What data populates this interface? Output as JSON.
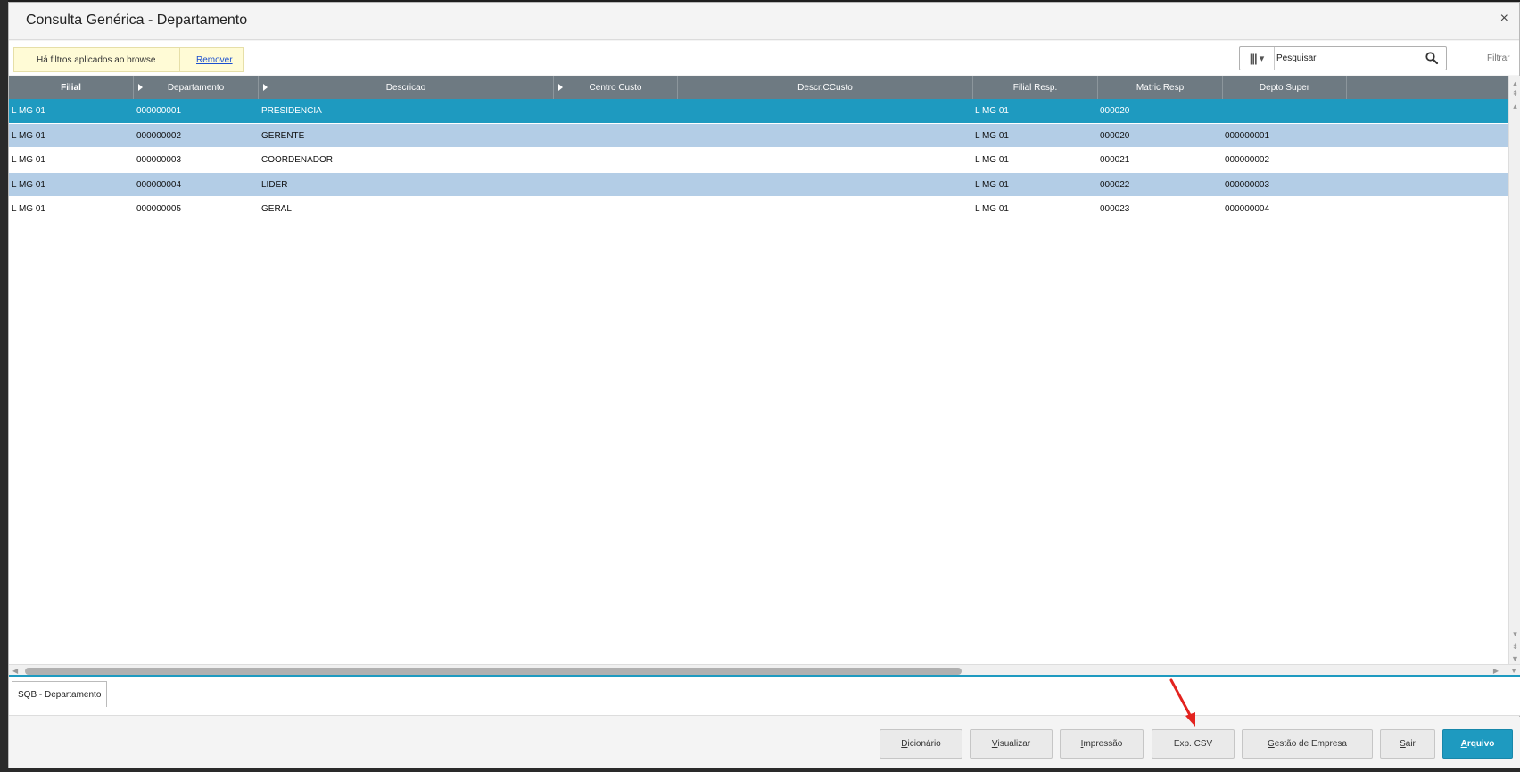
{
  "window": {
    "title": "Consulta Genérica - Departamento",
    "close_label": "×"
  },
  "toolbar": {
    "filter_notice": "Há filtros aplicados ao browse",
    "remove_link": "Remover",
    "search_placeholder": "Pesquisar",
    "filter_label": "Filtrar"
  },
  "grid": {
    "columns": [
      "Filial",
      "Departamento",
      "Descricao",
      "Centro Custo",
      "Descr.CCusto",
      "Filial Resp.",
      "Matric Resp",
      "Depto Super"
    ],
    "rows": [
      {
        "filial": "L MG 01",
        "departamento": "000000001",
        "descricao": "PRESIDENCIA",
        "centro_custo": "",
        "descr_ccusto": "",
        "filial_resp": "L MG 01",
        "matric_resp": "000020",
        "depto_super": "",
        "state": "selected"
      },
      {
        "filial": "L MG 01",
        "departamento": "000000002",
        "descricao": "GERENTE",
        "centro_custo": "",
        "descr_ccusto": "",
        "filial_resp": "L MG 01",
        "matric_resp": "000020",
        "depto_super": "000000001",
        "state": "alt"
      },
      {
        "filial": "L MG 01",
        "departamento": "000000003",
        "descricao": "COORDENADOR",
        "centro_custo": "",
        "descr_ccusto": "",
        "filial_resp": "L MG 01",
        "matric_resp": "000021",
        "depto_super": "000000002",
        "state": "plain"
      },
      {
        "filial": "L MG 01",
        "departamento": "000000004",
        "descricao": "LIDER",
        "centro_custo": "",
        "descr_ccusto": "",
        "filial_resp": "L MG 01",
        "matric_resp": "000022",
        "depto_super": "000000003",
        "state": "alt"
      },
      {
        "filial": "L MG 01",
        "departamento": "000000005",
        "descricao": "GERAL",
        "centro_custo": "",
        "descr_ccusto": "",
        "filial_resp": "L MG 01",
        "matric_resp": "000023",
        "depto_super": "000000004",
        "state": "plain"
      }
    ]
  },
  "tabs": [
    {
      "label": "SQB - Departamento"
    }
  ],
  "footer": {
    "buttons": [
      {
        "label": "Dicionário",
        "mnemonic": "D",
        "rest": "icionário"
      },
      {
        "label": "Visualizar",
        "mnemonic": "V",
        "rest": "isualizar"
      },
      {
        "label": "Impressão",
        "mnemonic": "I",
        "rest": "mpressão"
      },
      {
        "label": "Exp. CSV",
        "mnemonic": "",
        "rest": "Exp. CSV"
      },
      {
        "label": "Gestão de Empresa",
        "mnemonic": "G",
        "rest": "estão de Empresa"
      },
      {
        "label": "Sair",
        "mnemonic": "S",
        "rest": "air"
      },
      {
        "label": "Arquivo",
        "mnemonic": "A",
        "rest": "rquivo"
      }
    ]
  },
  "colors": {
    "accent": "#1e9ac0",
    "header_bg": "#6e7a82",
    "row_alt": "#b3cde6",
    "annotation_arrow": "#e3231f"
  },
  "icons": {
    "close": "close-icon",
    "columns": "columns-icon",
    "search": "search-icon",
    "sort": "sort-arrow-icon"
  }
}
